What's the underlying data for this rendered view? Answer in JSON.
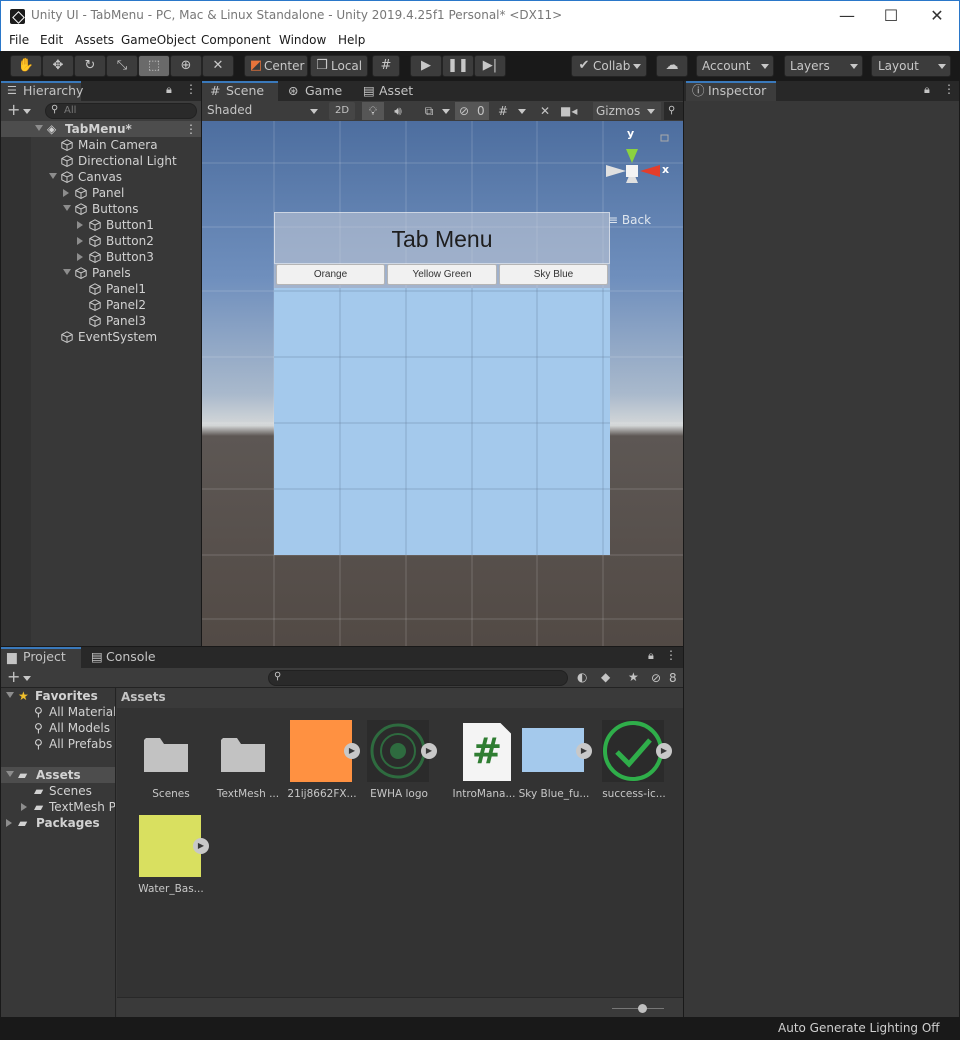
{
  "window": {
    "title": "Unity UI - TabMenu - PC, Mac & Linux Standalone - Unity 2019.4.25f1 Personal* <DX11>",
    "minimize": "—",
    "maximize": "☐",
    "close": "✕"
  },
  "menubar": [
    "File",
    "Edit",
    "Assets",
    "GameObject",
    "Component",
    "Window",
    "Help"
  ],
  "toolbar": {
    "pivot_label": "Center",
    "space_label": "Local",
    "collab_label": "Collab",
    "account_label": "Account",
    "layers_label": "Layers",
    "layout_label": "Layout"
  },
  "hierarchy": {
    "tab_label": "Hierarchy",
    "search_placeholder": "All",
    "scene_name": "TabMenu*",
    "items": [
      {
        "label": "Main Camera"
      },
      {
        "label": "Directional Light"
      },
      {
        "label": "Canvas"
      },
      {
        "label": "Panel"
      },
      {
        "label": "Buttons"
      },
      {
        "label": "Button1"
      },
      {
        "label": "Button2"
      },
      {
        "label": "Button3"
      },
      {
        "label": "Panels"
      },
      {
        "label": "Panel1"
      },
      {
        "label": "Panel2"
      },
      {
        "label": "Panel3"
      },
      {
        "label": "EventSystem"
      }
    ]
  },
  "scene": {
    "tabs": [
      "Scene",
      "Game",
      "Asset Store"
    ],
    "shading_mode": "Shaded",
    "mode_2d": "2D",
    "hidden_count": "0",
    "gizmos_label": "Gizmos",
    "gizmo_y": "y",
    "gizmo_x": "x",
    "back_label": "Back",
    "ui": {
      "title": "Tab Menu",
      "buttons": [
        "Orange",
        "Yellow Green",
        "Sky Blue"
      ],
      "panel_color": "#a4c9ec"
    }
  },
  "inspector": {
    "tab_label": "Inspector"
  },
  "project": {
    "tabs": [
      "Project",
      "Console"
    ],
    "hidden_count": "8",
    "tree": {
      "favorites": "Favorites",
      "favorite_items": [
        "All Materials",
        "All Models",
        "All Prefabs"
      ],
      "assets": "Assets",
      "asset_children": [
        "Scenes",
        "TextMesh P"
      ],
      "packages": "Packages"
    },
    "breadcrumb": "Assets",
    "assets": [
      {
        "label": "Scenes",
        "kind": "folder"
      },
      {
        "label": "TextMesh ...",
        "kind": "folder"
      },
      {
        "label": "21ij8662FX...",
        "kind": "texture",
        "color": "#ff9141"
      },
      {
        "label": "EWHA logo",
        "kind": "texture",
        "color": "#2e6b3f"
      },
      {
        "label": "IntroMana...",
        "kind": "script",
        "glyph": "#"
      },
      {
        "label": "Sky Blue_fu...",
        "kind": "texture",
        "color": "#a4c9ec"
      },
      {
        "label": "success-ic...",
        "kind": "texture",
        "color": "#2fae4a"
      },
      {
        "label": "Water_Bas...",
        "kind": "texture",
        "color": "#d9e060"
      }
    ]
  },
  "statusbar": {
    "message": "Auto Generate Lighting Off"
  }
}
